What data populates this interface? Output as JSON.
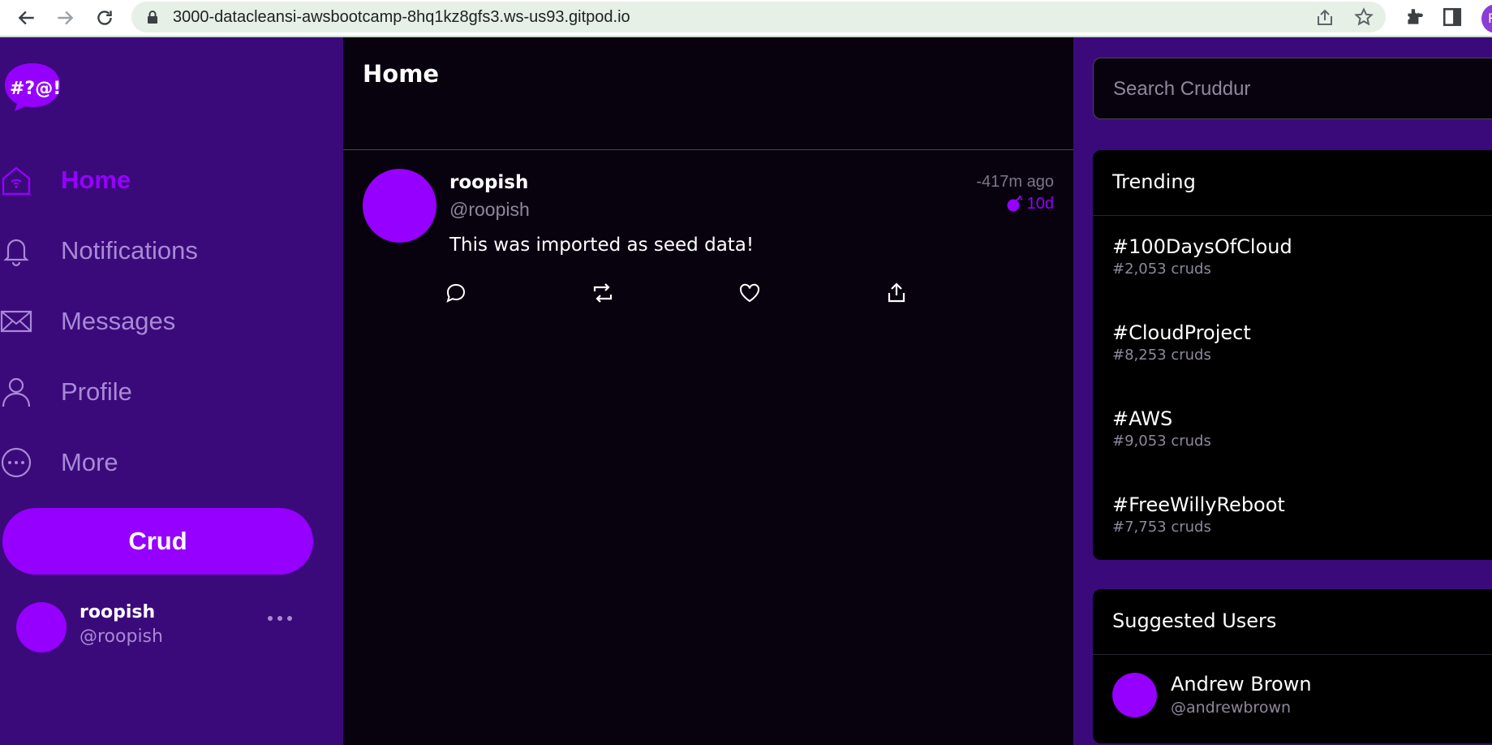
{
  "browser": {
    "url": "3000-datacleansi-awsbootcamp-8hq1kz8gfs3.ws-us93.gitpod.io",
    "profile_initial": "R"
  },
  "sidebar": {
    "logo_text": "#?@!",
    "items": [
      {
        "label": "Home",
        "icon": "home-icon",
        "active": true
      },
      {
        "label": "Notifications",
        "icon": "bell-icon",
        "active": false
      },
      {
        "label": "Messages",
        "icon": "envelope-icon",
        "active": false
      },
      {
        "label": "Profile",
        "icon": "person-icon",
        "active": false
      },
      {
        "label": "More",
        "icon": "more-circle-icon",
        "active": false
      }
    ],
    "crud_label": "Crud",
    "current_user": {
      "name": "roopish",
      "handle": "@roopish"
    }
  },
  "feed": {
    "title": "Home",
    "posts": [
      {
        "name": "roopish",
        "handle": "@roopish",
        "ago": "-417m ago",
        "expires": "10d",
        "message": "This was imported as seed data!"
      }
    ]
  },
  "search": {
    "placeholder": "Search Cruddur"
  },
  "trending": {
    "title": "Trending",
    "items": [
      {
        "tag": "#100DaysOfCloud",
        "count": "#2,053 cruds"
      },
      {
        "tag": "#CloudProject",
        "count": "#8,253 cruds"
      },
      {
        "tag": "#AWS",
        "count": "#9,053 cruds"
      },
      {
        "tag": "#FreeWillyReboot",
        "count": "#7,753 cruds"
      }
    ]
  },
  "suggested": {
    "title": "Suggested Users",
    "users": [
      {
        "name": "Andrew Brown",
        "handle": "@andrewbrown"
      }
    ]
  },
  "colors": {
    "accent": "#9500ff",
    "sidebar_bg": "#3b0a7a",
    "feed_bg": "#08020f",
    "muted_text": "#a889d6"
  }
}
